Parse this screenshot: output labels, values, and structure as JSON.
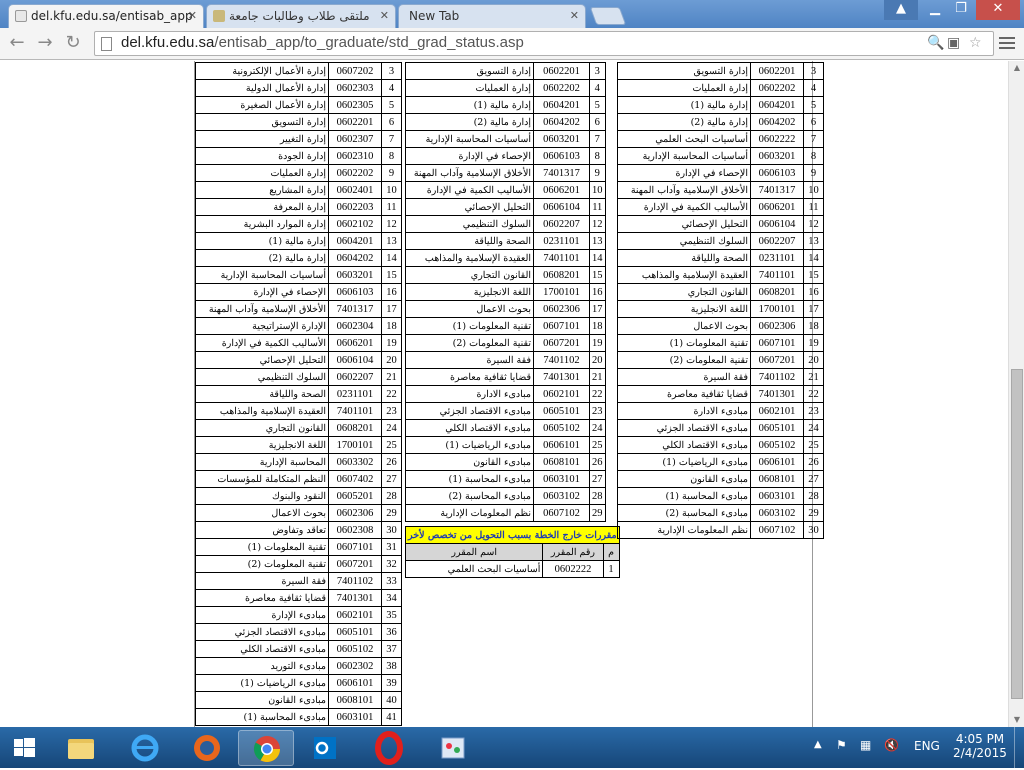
{
  "browser": {
    "tabs": [
      {
        "title": "del.kfu.edu.sa/entisab_app",
        "active": true
      },
      {
        "title": "ملتقى طلاب وطالبات جامعة",
        "active": false
      },
      {
        "title": "New Tab",
        "active": false
      }
    ],
    "url_host": "del.kfu.edu.sa",
    "url_path": "/entisab_app/to_graduate/std_grad_status.asp"
  },
  "left_table": {
    "rows": [
      {
        "no": "3",
        "code": "0607202",
        "name": "إدارة الأعمال الإلكترونية"
      },
      {
        "no": "4",
        "code": "0602303",
        "name": "إدارة الأعمال الدولية"
      },
      {
        "no": "5",
        "code": "0602305",
        "name": "إدارة الأعمال الصغيرة"
      },
      {
        "no": "6",
        "code": "0602201",
        "name": "إدارة التسويق"
      },
      {
        "no": "7",
        "code": "0602307",
        "name": "إدارة التغيير"
      },
      {
        "no": "8",
        "code": "0602310",
        "name": "إدارة الجودة"
      },
      {
        "no": "9",
        "code": "0602202",
        "name": "إدارة العمليات"
      },
      {
        "no": "10",
        "code": "0602401",
        "name": "إدارة المشاريع"
      },
      {
        "no": "11",
        "code": "0602203",
        "name": "إدارة المعرفة"
      },
      {
        "no": "12",
        "code": "0602102",
        "name": "إدارة الموارد البشرية"
      },
      {
        "no": "13",
        "code": "0604201",
        "name": "إدارة مالية (1)"
      },
      {
        "no": "14",
        "code": "0604202",
        "name": "إدارة مالية (2)"
      },
      {
        "no": "15",
        "code": "0603201",
        "name": "أساسيات المحاسبة الإدارية"
      },
      {
        "no": "16",
        "code": "0606103",
        "name": "الإحصاء في الإدارة"
      },
      {
        "no": "17",
        "code": "7401317",
        "name": "الأخلاق الإسلامية وآداب المهنة"
      },
      {
        "no": "18",
        "code": "0602304",
        "name": "الإدارة الإستراتيجية"
      },
      {
        "no": "19",
        "code": "0606201",
        "name": "الأساليب الكمية في الإدارة"
      },
      {
        "no": "20",
        "code": "0606104",
        "name": "التحليل الإحصائي"
      },
      {
        "no": "21",
        "code": "0602207",
        "name": "السلوك التنظيمي"
      },
      {
        "no": "22",
        "code": "0231101",
        "name": "الصحة واللياقة"
      },
      {
        "no": "23",
        "code": "7401101",
        "name": "العقيدة الإسلامية والمذاهب"
      },
      {
        "no": "24",
        "code": "0608201",
        "name": "القانون التجاري"
      },
      {
        "no": "25",
        "code": "1700101",
        "name": "اللغة الانجليزية"
      },
      {
        "no": "26",
        "code": "0603302",
        "name": "المحاسبة الإدارية"
      },
      {
        "no": "27",
        "code": "0607402",
        "name": "النظم المتكاملة للمؤسسات"
      },
      {
        "no": "28",
        "code": "0605201",
        "name": "النقود والبنوك"
      },
      {
        "no": "29",
        "code": "0602306",
        "name": "بحوث الاعمال"
      },
      {
        "no": "30",
        "code": "0602308",
        "name": "تعاقد وتفاوض"
      },
      {
        "no": "31",
        "code": "0607101",
        "name": "تقنية المعلومات (1)"
      },
      {
        "no": "32",
        "code": "0607201",
        "name": "تقنية المعلومات (2)"
      },
      {
        "no": "33",
        "code": "7401102",
        "name": "فقة السيرة"
      },
      {
        "no": "34",
        "code": "7401301",
        "name": "قضايا ثقافية معاصرة"
      },
      {
        "no": "35",
        "code": "0602101",
        "name": "مبادىء الإدارة"
      },
      {
        "no": "36",
        "code": "0605101",
        "name": "مبادىء الاقتصاد الجزئي"
      },
      {
        "no": "37",
        "code": "0605102",
        "name": "مبادىء الاقتصاد الكلي"
      },
      {
        "no": "38",
        "code": "0602302",
        "name": "مبادىء التوريد"
      },
      {
        "no": "39",
        "code": "0606101",
        "name": "مبادىء الرياضيات (1)"
      },
      {
        "no": "40",
        "code": "0608101",
        "name": "مبادىء القانون"
      },
      {
        "no": "41",
        "code": "0603101",
        "name": "مبادىء المحاسبة (1)"
      }
    ]
  },
  "middle_table": {
    "rows": [
      {
        "no": "3",
        "code": "0602201",
        "name": "إدارة التسويق"
      },
      {
        "no": "4",
        "code": "0602202",
        "name": "إدارة العمليات"
      },
      {
        "no": "5",
        "code": "0604201",
        "name": "إدارة مالية (1)"
      },
      {
        "no": "6",
        "code": "0604202",
        "name": "إدارة مالية (2)"
      },
      {
        "no": "7",
        "code": "0603201",
        "name": "أساسيات المحاسبة الإدارية"
      },
      {
        "no": "8",
        "code": "0606103",
        "name": "الإحصاء في الإدارة"
      },
      {
        "no": "9",
        "code": "7401317",
        "name": "الأخلاق الإسلامية وآداب المهنة"
      },
      {
        "no": "10",
        "code": "0606201",
        "name": "الأساليب الكمية في الإدارة"
      },
      {
        "no": "11",
        "code": "0606104",
        "name": "التحليل الإحصائي"
      },
      {
        "no": "12",
        "code": "0602207",
        "name": "السلوك التنظيمي"
      },
      {
        "no": "13",
        "code": "0231101",
        "name": "الصحة واللياقة"
      },
      {
        "no": "14",
        "code": "7401101",
        "name": "العقيدة الإسلامية والمذاهب"
      },
      {
        "no": "15",
        "code": "0608201",
        "name": "القانون التجاري"
      },
      {
        "no": "16",
        "code": "1700101",
        "name": "اللغة الانجليزية"
      },
      {
        "no": "17",
        "code": "0602306",
        "name": "بحوث الاعمال"
      },
      {
        "no": "18",
        "code": "0607101",
        "name": "تقنية المعلومات (1)"
      },
      {
        "no": "19",
        "code": "0607201",
        "name": "تقنية المعلومات (2)"
      },
      {
        "no": "20",
        "code": "7401102",
        "name": "فقة السيرة"
      },
      {
        "no": "21",
        "code": "7401301",
        "name": "قضايا ثقافية معاصرة"
      },
      {
        "no": "22",
        "code": "0602101",
        "name": "مبادىء الادارة"
      },
      {
        "no": "23",
        "code": "0605101",
        "name": "مبادىء الاقتصاد الجزئي"
      },
      {
        "no": "24",
        "code": "0605102",
        "name": "مبادىء الاقتصاد الكلي"
      },
      {
        "no": "25",
        "code": "0606101",
        "name": "مبادىء الرياضيات (1)"
      },
      {
        "no": "26",
        "code": "0608101",
        "name": "مبادىء القانون"
      },
      {
        "no": "27",
        "code": "0603101",
        "name": "مبادىء المحاسبة (1)"
      },
      {
        "no": "28",
        "code": "0603102",
        "name": "مبادىء المحاسبة (2)"
      },
      {
        "no": "29",
        "code": "0607102",
        "name": "نظم المعلومات الإدارية"
      }
    ]
  },
  "external_courses": {
    "title": "مقررات خارج الخطة بسبب التحويل من تخصص لأخر",
    "col_no": "م",
    "col_code": "رقم المقرر",
    "col_name": "اسم المقرر",
    "rows": [
      {
        "no": "1",
        "code": "0602222",
        "name": "أساسيات البحث العلمي"
      }
    ]
  },
  "right_table": {
    "rows": [
      {
        "no": "3",
        "code": "0602201",
        "name": "إدارة التسويق"
      },
      {
        "no": "4",
        "code": "0602202",
        "name": "إدارة العمليات"
      },
      {
        "no": "5",
        "code": "0604201",
        "name": "إدارة مالية (1)"
      },
      {
        "no": "6",
        "code": "0604202",
        "name": "إدارة مالية (2)"
      },
      {
        "no": "7",
        "code": "0602222",
        "name": "أساسيات البحث العلمي"
      },
      {
        "no": "8",
        "code": "0603201",
        "name": "أساسيات المحاسبة الإدارية"
      },
      {
        "no": "9",
        "code": "0606103",
        "name": "الإحصاء في الإدارة"
      },
      {
        "no": "10",
        "code": "7401317",
        "name": "الأخلاق الإسلامية وآداب المهنة"
      },
      {
        "no": "11",
        "code": "0606201",
        "name": "الأساليب الكمية في الإدارة"
      },
      {
        "no": "12",
        "code": "0606104",
        "name": "التحليل الإحصائي"
      },
      {
        "no": "13",
        "code": "0602207",
        "name": "السلوك التنظيمي"
      },
      {
        "no": "14",
        "code": "0231101",
        "name": "الصحة واللياقة"
      },
      {
        "no": "15",
        "code": "7401101",
        "name": "العقيدة الإسلامية والمذاهب"
      },
      {
        "no": "16",
        "code": "0608201",
        "name": "القانون التجاري"
      },
      {
        "no": "17",
        "code": "1700101",
        "name": "اللغة الانجليزية"
      },
      {
        "no": "18",
        "code": "0602306",
        "name": "بحوث الاعمال"
      },
      {
        "no": "19",
        "code": "0607101",
        "name": "تقنية المعلومات (1)"
      },
      {
        "no": "20",
        "code": "0607201",
        "name": "تقنية المعلومات (2)"
      },
      {
        "no": "21",
        "code": "7401102",
        "name": "فقة السيرة"
      },
      {
        "no": "22",
        "code": "7401301",
        "name": "قضايا ثقافية معاصرة"
      },
      {
        "no": "23",
        "code": "0602101",
        "name": "مبادىء الادارة"
      },
      {
        "no": "24",
        "code": "0605101",
        "name": "مبادىء الاقتصاد الجزئي"
      },
      {
        "no": "25",
        "code": "0605102",
        "name": "مبادىء الاقتصاد الكلي"
      },
      {
        "no": "26",
        "code": "0606101",
        "name": "مبادىء الرياضيات (1)"
      },
      {
        "no": "27",
        "code": "0608101",
        "name": "مبادىء القانون"
      },
      {
        "no": "28",
        "code": "0603101",
        "name": "مبادىء المحاسبة (1)"
      },
      {
        "no": "29",
        "code": "0603102",
        "name": "مبادىء المحاسبة (2)"
      },
      {
        "no": "30",
        "code": "0607102",
        "name": "نظم المعلومات الإدارية"
      }
    ]
  },
  "taskbar": {
    "language": "ENG",
    "time": "4:05 PM",
    "date": "2/4/2015",
    "apps": [
      "start-button",
      "file-explorer",
      "internet-explorer",
      "firefox",
      "chrome",
      "outlook",
      "opera",
      "paint"
    ]
  },
  "colors": {
    "ext_header_bg": "#ffff00",
    "ext_header_text": "#1f3bb3",
    "titlebar": "#4f84c4"
  }
}
